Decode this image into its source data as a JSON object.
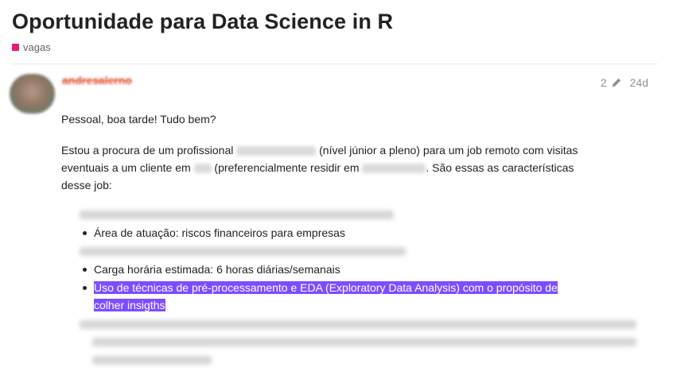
{
  "topic": {
    "title": "Oportunidade para Data Science in R",
    "category": "vagas",
    "category_color": "#e8197a"
  },
  "post": {
    "author": "andresalerno",
    "edit_count": "2",
    "age": "24d",
    "greeting": "Pessoal, boa tarde! Tudo bem?",
    "para_part1": "Estou a procura de um profissional",
    "para_part2": "(nível júnior a pleno) para um job remoto com visitas",
    "para_line2_a": "eventuais a um cliente em",
    "para_line2_b": "(preferencialmente residir em",
    "para_line2_c": ". São essas as características",
    "para_line3": "desse job:",
    "bullets": {
      "area": "Área de atuação: riscos financeiros para empresas",
      "carga": "Carga horária estimada: 6 horas diárias/semanais",
      "uso_line1": "Uso de técnicas de pré-processamento e EDA (Exploratory Data Analysis) com o propósito de",
      "uso_line2": "colher insigths"
    },
    "highlight_color": "#7c4dff"
  },
  "icons": {
    "edit": "pencil-icon"
  }
}
